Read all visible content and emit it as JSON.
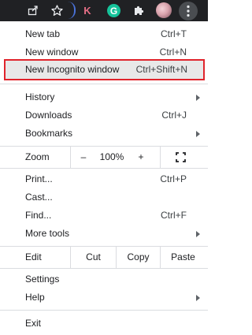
{
  "toolbar": {
    "share_icon": "share-icon",
    "star_icon": "bookmark-star-icon",
    "ext_k_label": "K",
    "ext_g_label": "G",
    "extensions_icon": "puzzle-icon",
    "menu_icon": "kebab-menu-icon"
  },
  "menu": {
    "new_tab": {
      "label": "New tab",
      "shortcut": "Ctrl+T"
    },
    "new_window": {
      "label": "New window",
      "shortcut": "Ctrl+N"
    },
    "new_incognito": {
      "label": "New Incognito window",
      "shortcut": "Ctrl+Shift+N"
    },
    "history": {
      "label": "History"
    },
    "downloads": {
      "label": "Downloads",
      "shortcut": "Ctrl+J"
    },
    "bookmarks": {
      "label": "Bookmarks"
    },
    "zoom": {
      "label": "Zoom",
      "minus": "–",
      "value": "100%",
      "plus": "+"
    },
    "print": {
      "label": "Print...",
      "shortcut": "Ctrl+P"
    },
    "cast": {
      "label": "Cast..."
    },
    "find": {
      "label": "Find...",
      "shortcut": "Ctrl+F"
    },
    "more_tools": {
      "label": "More tools"
    },
    "edit": {
      "label": "Edit",
      "cut": "Cut",
      "copy": "Copy",
      "paste": "Paste"
    },
    "settings": {
      "label": "Settings"
    },
    "help": {
      "label": "Help"
    },
    "exit": {
      "label": "Exit"
    }
  },
  "colors": {
    "toolbar_bg": "#202124",
    "highlight_border": "#e0242c",
    "highlight_bg": "#e8e8e8"
  }
}
